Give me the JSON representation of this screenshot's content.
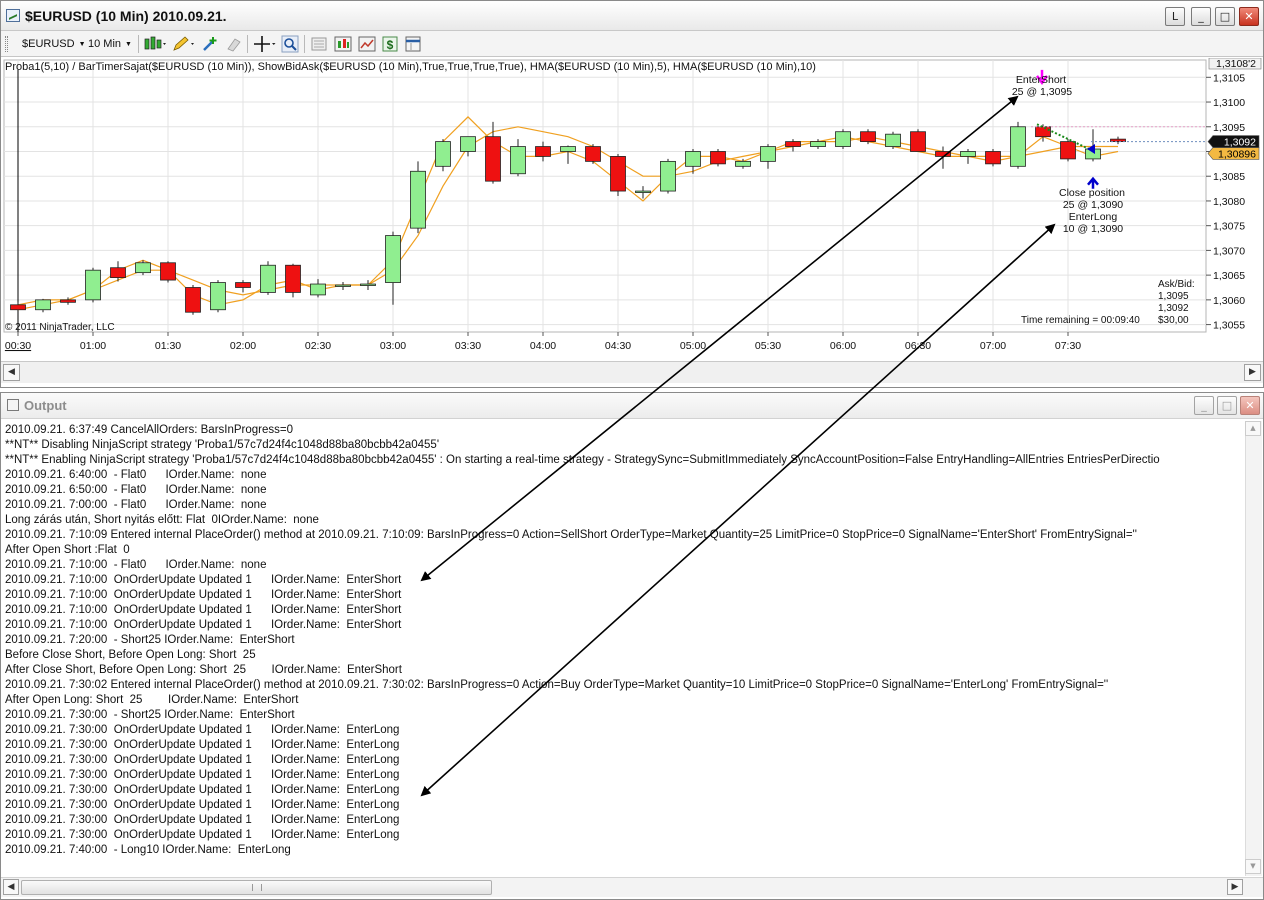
{
  "chart_window": {
    "title": "$EURUSD (10 Min)  2010.09.21.",
    "controls": {
      "restore": "L",
      "minimize": "_",
      "maximize": "□",
      "close": "✕"
    },
    "toolbar": {
      "instrument": "$EURUSD",
      "interval": "10 Min",
      "icons": [
        "candlestick-style-icon",
        "pencil-draw-icon",
        "crosshair-plus-icon",
        "eraser-icon",
        "crosshair-icon",
        "zoom-icon",
        "data-box-icon",
        "strategies-icon",
        "indicators-icon",
        "order-ticket-icon",
        "properties-icon"
      ]
    },
    "indicator_caption": "Proba1(5,10)  / BarTimerSajat($EURUSD (10 Min)), ShowBidAsk($EURUSD (10 Min),True,True,True,True), HMA($EURUSD (10 Min),5), HMA($EURUSD (10 Min),10)",
    "copyright": "© 2011 NinjaTrader, LLC",
    "time_remaining": "Time remaining = 00:09:40",
    "ask_bid": {
      "label": "Ask/Bid:",
      "ask": "1,3095",
      "bid": "1,3092",
      "spread": "$30,00"
    },
    "annotations": {
      "enter_short_title": "EnterShort",
      "enter_short_detail": "25 @ 1,3095",
      "close_title": "Close position",
      "close_detail": "25 @ 1,3090",
      "enter_long_title": "EnterLong",
      "enter_long_detail": "10 @ 1,3090"
    },
    "price_flags": {
      "top": "1,3108'2",
      "last": "1,3092",
      "lower": "1,30896"
    }
  },
  "chart_data": {
    "type": "candlestick",
    "x_tick_labels": [
      "00:30",
      "01:00",
      "01:30",
      "02:00",
      "02:30",
      "03:00",
      "03:30",
      "04:00",
      "04:30",
      "05:00",
      "05:30",
      "06:00",
      "06:30",
      "07:00",
      "07:30"
    ],
    "y_tick_labels": [
      "1,3105",
      "1,3100",
      "1,3095",
      "1,3090",
      "1,3085",
      "1,3080",
      "1,3075",
      "1,3070",
      "1,3065",
      "1,3060",
      "1,3055"
    ],
    "ylim": [
      1.30535,
      1.31085
    ],
    "candles": [
      {
        "o": 1.3059,
        "h": 1.30595,
        "l": 1.3058,
        "c": 1.3058
      },
      {
        "o": 1.3058,
        "h": 1.30602,
        "l": 1.30575,
        "c": 1.306
      },
      {
        "o": 1.306,
        "h": 1.30605,
        "l": 1.3059,
        "c": 1.30595
      },
      {
        "o": 1.306,
        "h": 1.30665,
        "l": 1.30595,
        "c": 1.3066
      },
      {
        "o": 1.30665,
        "h": 1.30678,
        "l": 1.30637,
        "c": 1.30645
      },
      {
        "o": 1.30655,
        "h": 1.3068,
        "l": 1.3065,
        "c": 1.30675
      },
      {
        "o": 1.30675,
        "h": 1.30678,
        "l": 1.30635,
        "c": 1.3064
      },
      {
        "o": 1.30625,
        "h": 1.3063,
        "l": 1.3057,
        "c": 1.30575
      },
      {
        "o": 1.3058,
        "h": 1.3064,
        "l": 1.30575,
        "c": 1.30635
      },
      {
        "o": 1.30635,
        "h": 1.3064,
        "l": 1.30615,
        "c": 1.30625
      },
      {
        "o": 1.30615,
        "h": 1.30678,
        "l": 1.3061,
        "c": 1.3067
      },
      {
        "o": 1.3067,
        "h": 1.30673,
        "l": 1.30605,
        "c": 1.30615
      },
      {
        "o": 1.3061,
        "h": 1.30642,
        "l": 1.30605,
        "c": 1.30632
      },
      {
        "o": 1.3063,
        "h": 1.30636,
        "l": 1.3062,
        "c": 1.3063
      },
      {
        "o": 1.3063,
        "h": 1.3064,
        "l": 1.3062,
        "c": 1.30632
      },
      {
        "o": 1.30635,
        "h": 1.30738,
        "l": 1.3059,
        "c": 1.3073
      },
      {
        "o": 1.30745,
        "h": 1.3088,
        "l": 1.30735,
        "c": 1.3086
      },
      {
        "o": 1.3087,
        "h": 1.30925,
        "l": 1.3086,
        "c": 1.3092
      },
      {
        "o": 1.309,
        "h": 1.3093,
        "l": 1.3089,
        "c": 1.3093
      },
      {
        "o": 1.3093,
        "h": 1.3096,
        "l": 1.30835,
        "c": 1.3084
      },
      {
        "o": 1.30855,
        "h": 1.30925,
        "l": 1.3085,
        "c": 1.3091
      },
      {
        "o": 1.3091,
        "h": 1.3092,
        "l": 1.3088,
        "c": 1.3089
      },
      {
        "o": 1.309,
        "h": 1.30912,
        "l": 1.30875,
        "c": 1.3091
      },
      {
        "o": 1.3091,
        "h": 1.30915,
        "l": 1.30875,
        "c": 1.3088
      },
      {
        "o": 1.3089,
        "h": 1.30895,
        "l": 1.3081,
        "c": 1.3082
      },
      {
        "o": 1.3082,
        "h": 1.3083,
        "l": 1.30805,
        "c": 1.3082
      },
      {
        "o": 1.3082,
        "h": 1.30885,
        "l": 1.30815,
        "c": 1.3088
      },
      {
        "o": 1.3087,
        "h": 1.30905,
        "l": 1.30855,
        "c": 1.309
      },
      {
        "o": 1.309,
        "h": 1.30905,
        "l": 1.3087,
        "c": 1.30875
      },
      {
        "o": 1.3087,
        "h": 1.30885,
        "l": 1.30865,
        "c": 1.3088
      },
      {
        "o": 1.3088,
        "h": 1.30915,
        "l": 1.30865,
        "c": 1.3091
      },
      {
        "o": 1.3092,
        "h": 1.30925,
        "l": 1.309,
        "c": 1.3091
      },
      {
        "o": 1.3091,
        "h": 1.30925,
        "l": 1.30905,
        "c": 1.3092
      },
      {
        "o": 1.3091,
        "h": 1.30945,
        "l": 1.30905,
        "c": 1.3094
      },
      {
        "o": 1.3094,
        "h": 1.30945,
        "l": 1.30915,
        "c": 1.3092
      },
      {
        "o": 1.3091,
        "h": 1.3094,
        "l": 1.30905,
        "c": 1.30935
      },
      {
        "o": 1.3094,
        "h": 1.30945,
        "l": 1.309,
        "c": 1.309
      },
      {
        "o": 1.309,
        "h": 1.3091,
        "l": 1.30865,
        "c": 1.3089
      },
      {
        "o": 1.3089,
        "h": 1.30905,
        "l": 1.30875,
        "c": 1.309
      },
      {
        "o": 1.309,
        "h": 1.30905,
        "l": 1.3087,
        "c": 1.30875
      },
      {
        "o": 1.3087,
        "h": 1.3096,
        "l": 1.30865,
        "c": 1.3095
      },
      {
        "o": 1.3095,
        "h": 1.30955,
        "l": 1.3092,
        "c": 1.3093
      },
      {
        "o": 1.3092,
        "h": 1.30925,
        "l": 1.3088,
        "c": 1.30885
      },
      {
        "o": 1.30885,
        "h": 1.30945,
        "l": 1.3088,
        "c": 1.30905
      },
      {
        "o": 1.30925,
        "h": 1.3093,
        "l": 1.30915,
        "c": 1.3092
      }
    ],
    "hma_5": [
      1.3059,
      1.306,
      1.306,
      1.3062,
      1.3066,
      1.3068,
      1.3066,
      1.3061,
      1.3059,
      1.306,
      1.3063,
      1.3064,
      1.3062,
      1.3063,
      1.3063,
      1.3068,
      1.308,
      1.3092,
      1.3097,
      1.3092,
      1.3089,
      1.3089,
      1.309,
      1.3088,
      1.3084,
      1.308,
      1.3085,
      1.3089,
      1.3089,
      1.3088,
      1.309,
      1.3092,
      1.3092,
      1.3093,
      1.3092,
      1.3091,
      1.309,
      1.3089,
      1.3089,
      1.3088,
      1.3089,
      1.3093,
      1.3091,
      1.3089,
      1.309
    ],
    "hma_10": [
      1.3058,
      1.3059,
      1.306,
      1.3062,
      1.3064,
      1.3066,
      1.3066,
      1.3064,
      1.3062,
      1.3061,
      1.3062,
      1.3063,
      1.3063,
      1.3063,
      1.3063,
      1.3066,
      1.3073,
      1.3083,
      1.3091,
      1.3094,
      1.3095,
      1.3094,
      1.3093,
      1.3091,
      1.3088,
      1.3085,
      1.3085,
      1.3086,
      1.3088,
      1.3089,
      1.309,
      1.3091,
      1.3092,
      1.3092,
      1.3093,
      1.3092,
      1.3091,
      1.309,
      1.3089,
      1.3089,
      1.3089,
      1.309,
      1.3091,
      1.3091,
      1.3091
    ],
    "colors": {
      "up": "#90ee90",
      "down": "#ee1111",
      "outline": "#222222",
      "hma": "#f0a020"
    }
  },
  "output_window": {
    "title": "Output",
    "controls": {
      "minimize": "_",
      "maximize": "□",
      "close": "✕"
    },
    "lines": [
      "2010.09.21. 6:37:49 CancelAllOrders: BarsInProgress=0",
      "**NT** Disabling NinjaScript strategy 'Proba1/57c7d24f4c1048d88ba80bcbb42a0455'",
      "**NT** Enabling NinjaScript strategy 'Proba1/57c7d24f4c1048d88ba80bcbb42a0455' : On starting a real-time strategy - StrategySync=SubmitImmediately SyncAccountPosition=False EntryHandling=AllEntries EntriesPerDirectio",
      "2010.09.21. 6:40:00  - Flat0      IOrder.Name:  none",
      "2010.09.21. 6:50:00  - Flat0      IOrder.Name:  none",
      "2010.09.21. 7:00:00  - Flat0      IOrder.Name:  none",
      "Long zárás után, Short nyitás előtt: Flat  0IOrder.Name:  none",
      "2010.09.21. 7:10:09 Entered internal PlaceOrder() method at 2010.09.21. 7:10:09: BarsInProgress=0 Action=SellShort OrderType=Market Quantity=25 LimitPrice=0 StopPrice=0 SignalName='EnterShort' FromEntrySignal=''",
      "After Open Short :Flat  0",
      "2010.09.21. 7:10:00  - Flat0      IOrder.Name:  none",
      "2010.09.21. 7:10:00  OnOrderUpdate Updated 1      IOrder.Name:  EnterShort",
      "2010.09.21. 7:10:00  OnOrderUpdate Updated 1      IOrder.Name:  EnterShort",
      "2010.09.21. 7:10:00  OnOrderUpdate Updated 1      IOrder.Name:  EnterShort",
      "2010.09.21. 7:10:00  OnOrderUpdate Updated 1      IOrder.Name:  EnterShort",
      "2010.09.21. 7:20:00  - Short25 IOrder.Name:  EnterShort",
      "Before Close Short, Before Open Long: Short  25",
      "After Close Short, Before Open Long: Short  25        IOrder.Name:  EnterShort",
      "2010.09.21. 7:30:02 Entered internal PlaceOrder() method at 2010.09.21. 7:30:02: BarsInProgress=0 Action=Buy OrderType=Market Quantity=10 LimitPrice=0 StopPrice=0 SignalName='EnterLong' FromEntrySignal=''",
      "After Open Long: Short  25        IOrder.Name:  EnterShort",
      "2010.09.21. 7:30:00  - Short25 IOrder.Name:  EnterShort",
      "2010.09.21. 7:30:00  OnOrderUpdate Updated 1      IOrder.Name:  EnterLong",
      "2010.09.21. 7:30:00  OnOrderUpdate Updated 1      IOrder.Name:  EnterLong",
      "2010.09.21. 7:30:00  OnOrderUpdate Updated 1      IOrder.Name:  EnterLong",
      "2010.09.21. 7:30:00  OnOrderUpdate Updated 1      IOrder.Name:  EnterLong",
      "2010.09.21. 7:30:00  OnOrderUpdate Updated 1      IOrder.Name:  EnterLong",
      "2010.09.21. 7:30:00  OnOrderUpdate Updated 1      IOrder.Name:  EnterLong",
      "2010.09.21. 7:30:00  OnOrderUpdate Updated 1      IOrder.Name:  EnterLong",
      "2010.09.21. 7:30:00  OnOrderUpdate Updated 1      IOrder.Name:  EnterLong",
      "2010.09.21. 7:40:00  - Long10 IOrder.Name:  EnterLong"
    ]
  }
}
